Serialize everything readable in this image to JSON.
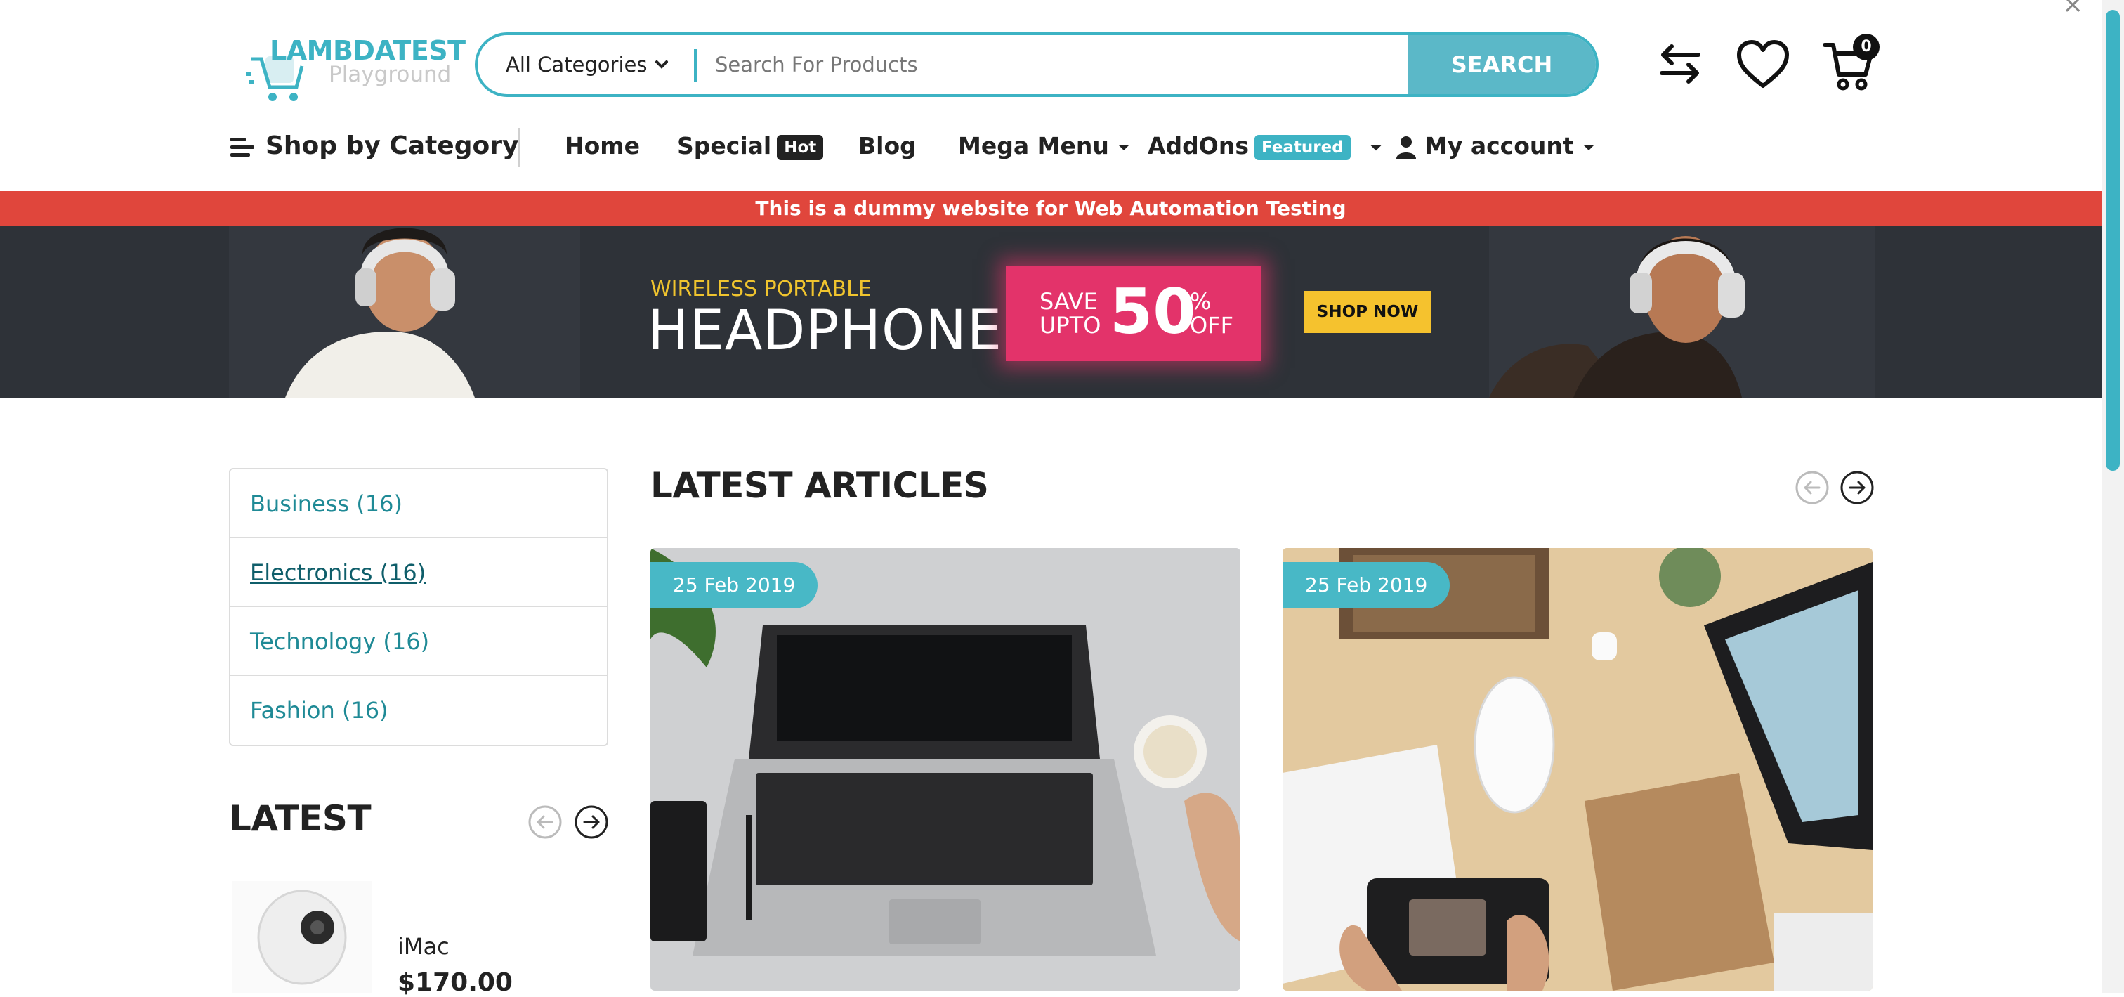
{
  "header": {
    "logo_title": "LAMBDATEST",
    "logo_subtitle": "Playground",
    "search": {
      "category": "All Categories",
      "placeholder": "Search For Products",
      "button": "SEARCH"
    },
    "cart_count": "0",
    "icons": [
      "compare-icon",
      "wishlist-heart-icon",
      "cart-icon"
    ]
  },
  "nav": {
    "shop_by_category": "Shop by Category",
    "home": "Home",
    "special": "Special",
    "special_badge": "Hot",
    "blog": "Blog",
    "mega_menu": "Mega Menu",
    "addons": "AddOns",
    "addons_badge": "Featured",
    "my_account": "My account"
  },
  "promo_text": "This is a dummy website for Web Automation Testing",
  "banner": {
    "kicker": "WIRELESS PORTABLE",
    "title": "HEADPHONE",
    "save": "SAVE",
    "upto": "UPTO",
    "discount": "50",
    "percent": "%",
    "off": "OFF",
    "cta": "SHOP NOW"
  },
  "categories": [
    {
      "label": "Business (16)"
    },
    {
      "label": "Electronics (16)"
    },
    {
      "label": "Technology (16)"
    },
    {
      "label": "Fashion (16)"
    }
  ],
  "latest": {
    "title": "LATEST",
    "product": {
      "name": "iMac",
      "price": "$170.00"
    }
  },
  "articles": {
    "title": "LATEST ARTICLES",
    "items": [
      {
        "date": "25 Feb 2019"
      },
      {
        "date": "25 Feb 2019"
      }
    ]
  },
  "colors": {
    "accent": "#3db3c4",
    "promo": "#e0463c",
    "banner_bg": "#2e3238",
    "badge_hot": "#222222",
    "discount": "#e3336a",
    "shop_now": "#f5c22e"
  }
}
